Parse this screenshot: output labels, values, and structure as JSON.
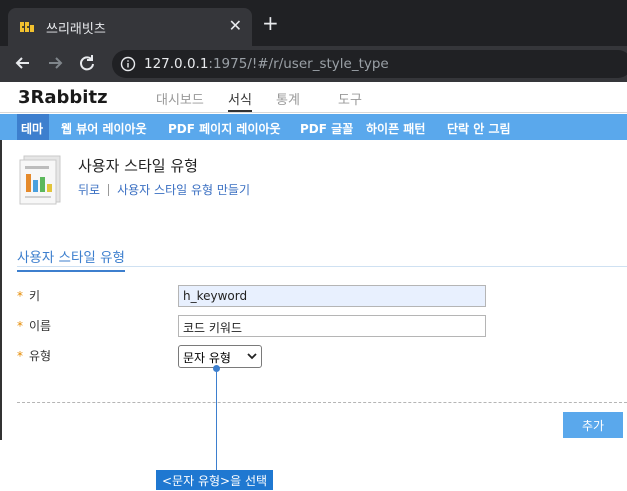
{
  "browser": {
    "tab_title": "쓰리래빗츠",
    "url_host": "127.0.0.1",
    "url_rest": ":1975/!#/r/user_style_type"
  },
  "app": {
    "logo": "3Rabbitz",
    "top_nav": [
      "대시보드",
      "서식",
      "통계",
      "도구"
    ],
    "top_nav_active": "서식",
    "menu": [
      "테마",
      "웹 뷰어 레이아웃",
      "PDF 페이지 레이아웃",
      "PDF 글꼴",
      "하이픈 패턴",
      "단락 안 그림"
    ],
    "menu_active": "테마"
  },
  "page": {
    "title": "사용자 스타일 유형",
    "link_back": "뒤로",
    "link_create": "사용자 스타일 유형 만들기",
    "section_title": "사용자 스타일 유형"
  },
  "form": {
    "required_mark": "*",
    "key_label": "키",
    "key_value": "h_keyword",
    "name_label": "이름",
    "name_value": "코드 키워드",
    "type_label": "유형",
    "type_value": "문자 유형",
    "add_button": "추가"
  },
  "callout": {
    "text": "<문자 유형>을 선택"
  },
  "colors": {
    "accent": "#5aa8ec",
    "accent_dark": "#3d7fce",
    "required": "#e58a00"
  }
}
